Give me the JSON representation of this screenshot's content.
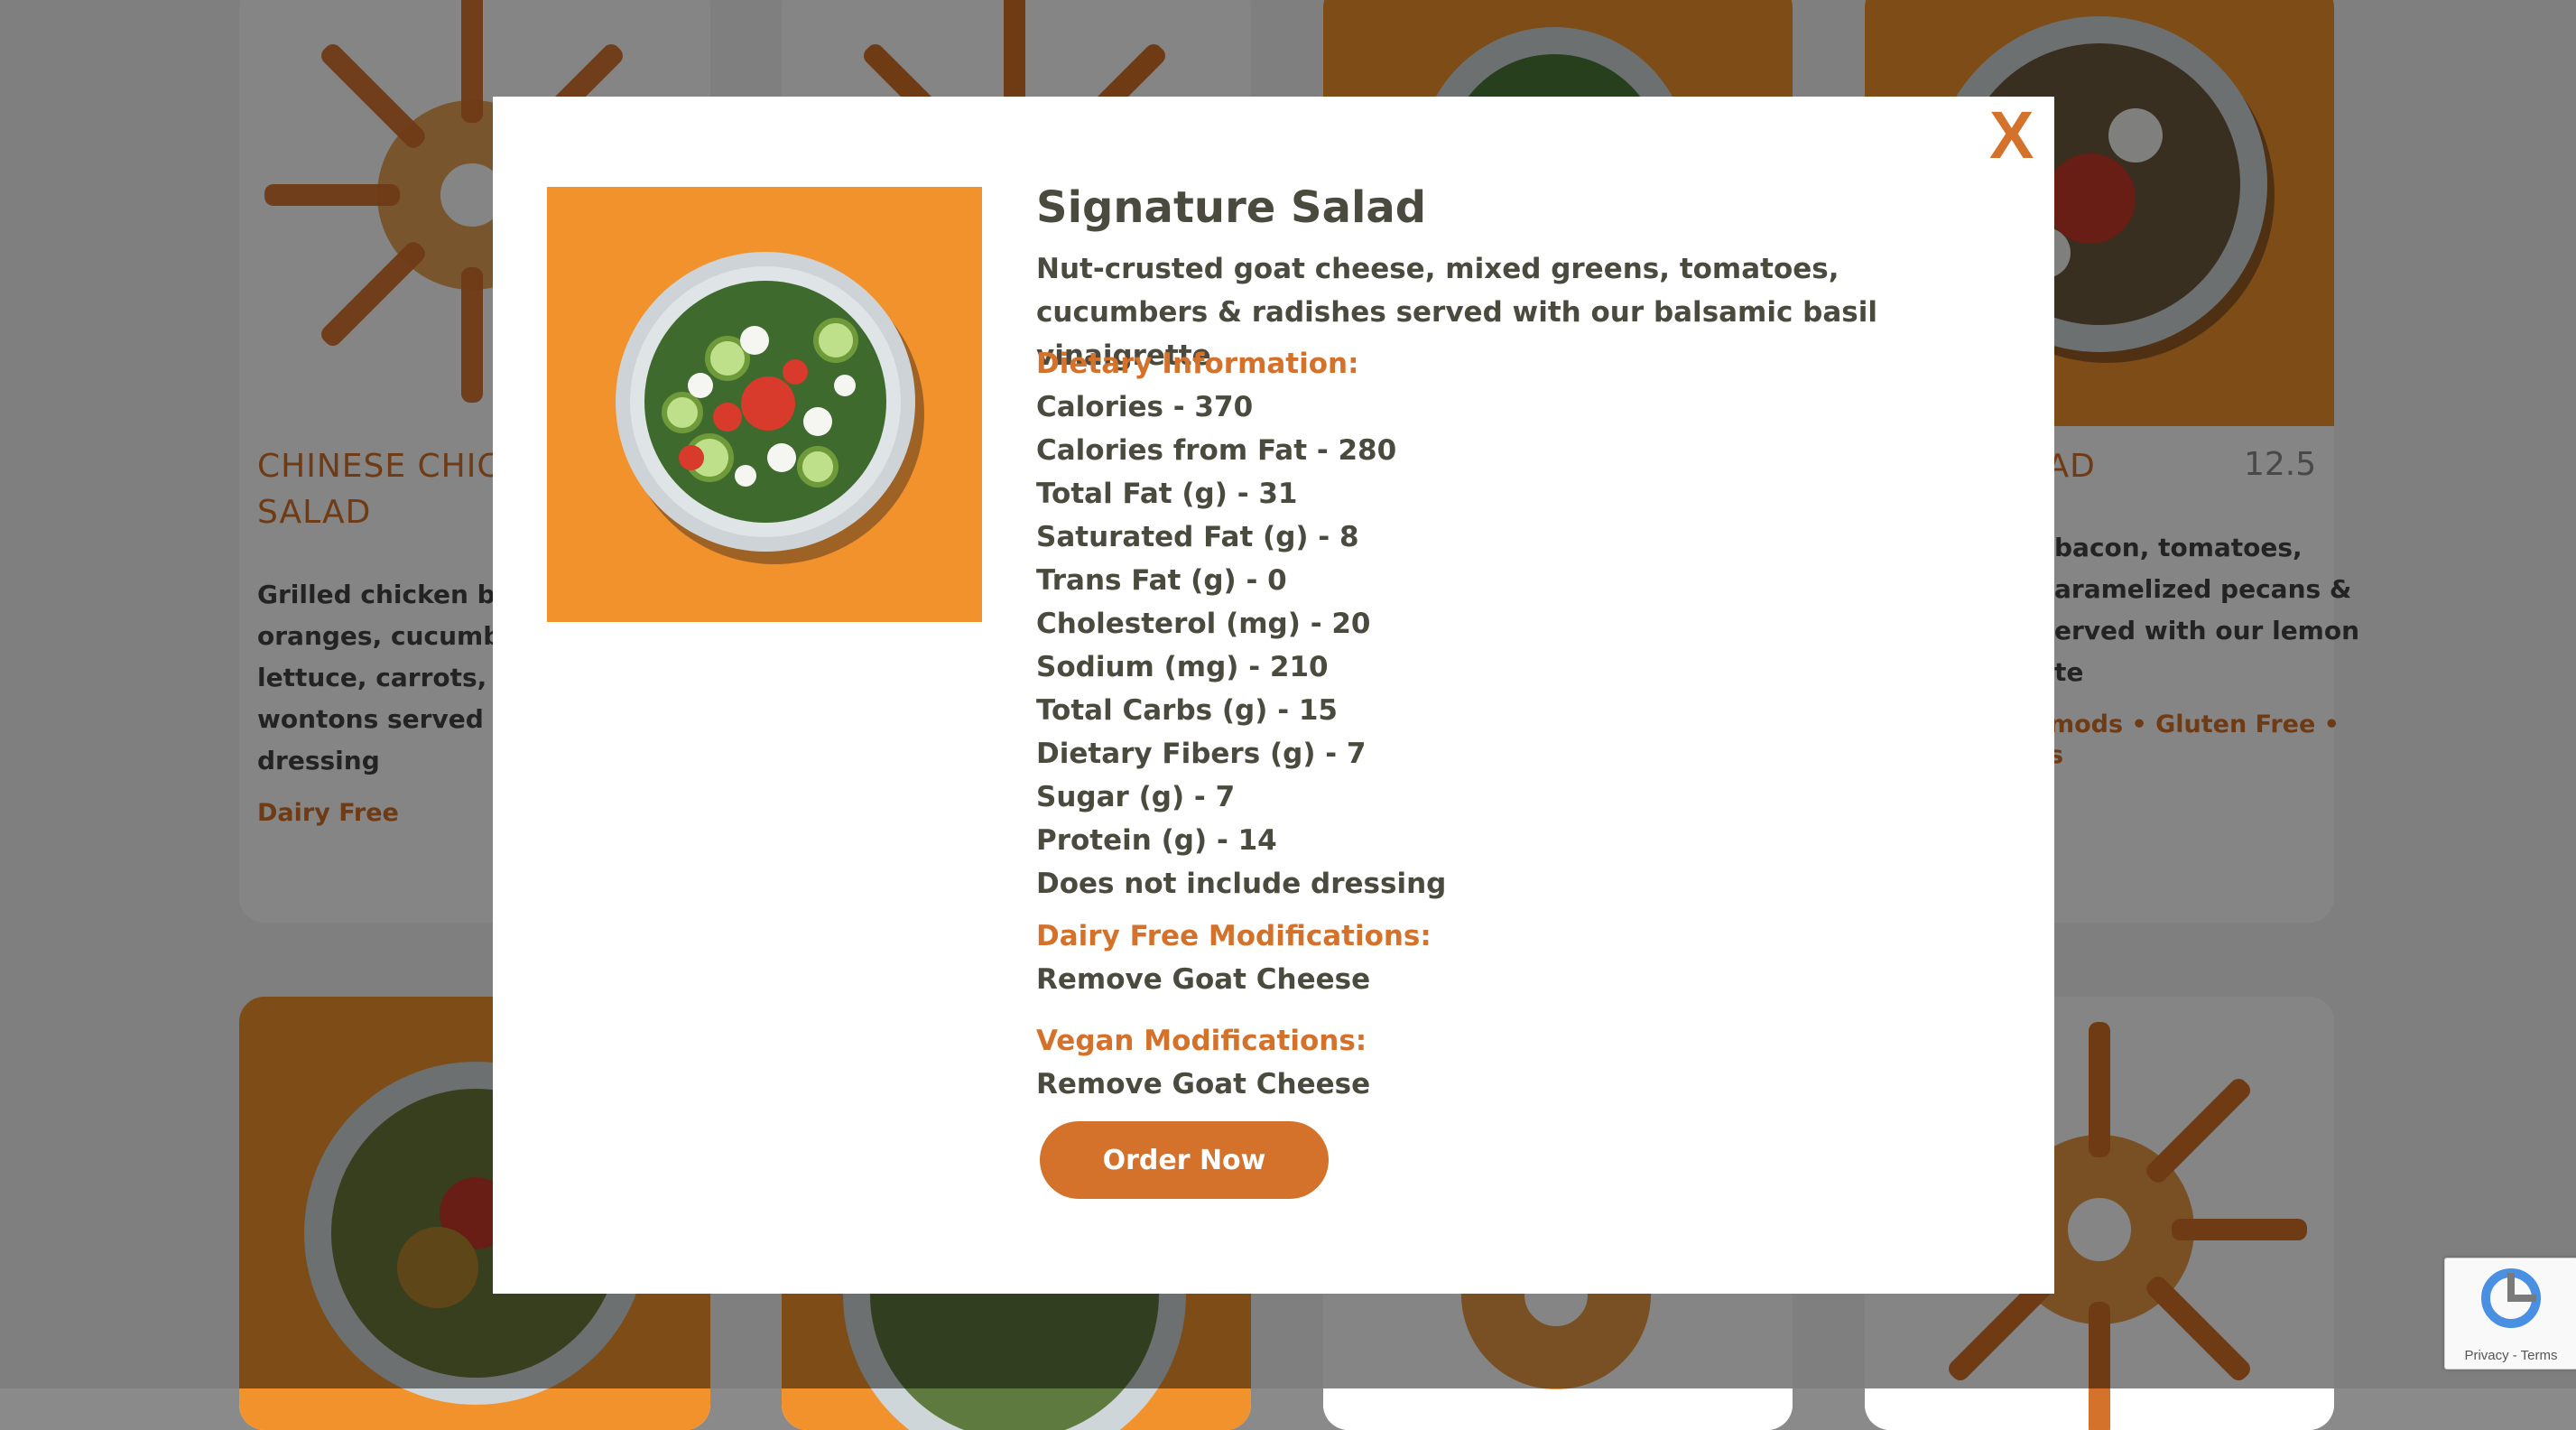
{
  "cards_behind": [
    {
      "title_line1": "CHINESE CHICK",
      "title_line2": "SALAD",
      "desc_lines": [
        "Grilled chicken brea",
        "oranges, cucumber",
        "lettuce, carrots, sca",
        "wontons served wit",
        "dressing"
      ],
      "tags": "Dairy Free"
    },
    {
      "title_line1": "ALAD",
      "price": "12.5",
      "desc_lines": [
        "bacon, tomatoes,",
        "aramelized pecans &",
        "erved with our lemon",
        "te"
      ],
      "tags_line1": "mods • Gluten Free •",
      "tags_line2": "s"
    }
  ],
  "modal": {
    "close_label": "X",
    "title": "Signature Salad",
    "description": "Nut-crusted goat cheese, mixed greens, tomatoes, cucumbers & radishes served with our balsamic basil vinaigrette",
    "dietary_heading": "Dietary Information:",
    "dietary_items": [
      "Calories - 370",
      "Calories from Fat - 280",
      "Total Fat (g) - 31",
      "Saturated Fat (g) - 8",
      "Trans Fat (g) - 0",
      "Cholesterol (mg) - 20",
      "Sodium (mg) - 210",
      "Total Carbs (g) - 15",
      "Dietary Fibers (g) - 7",
      "Sugar (g) - 7",
      "Protein (g) - 14",
      "Does not include dressing"
    ],
    "dairy_free_heading": "Dairy Free Modifications:",
    "dairy_free_text": "Remove Goat Cheese",
    "vegan_heading": "Vegan Modifications:",
    "vegan_text": "Remove Goat Cheese",
    "order_button": "Order Now"
  },
  "recaptcha": {
    "links": "Privacy - Terms"
  },
  "colors": {
    "accent": "#d4712a",
    "orange_bg": "#f2922d",
    "text": "#4a4a3e"
  }
}
